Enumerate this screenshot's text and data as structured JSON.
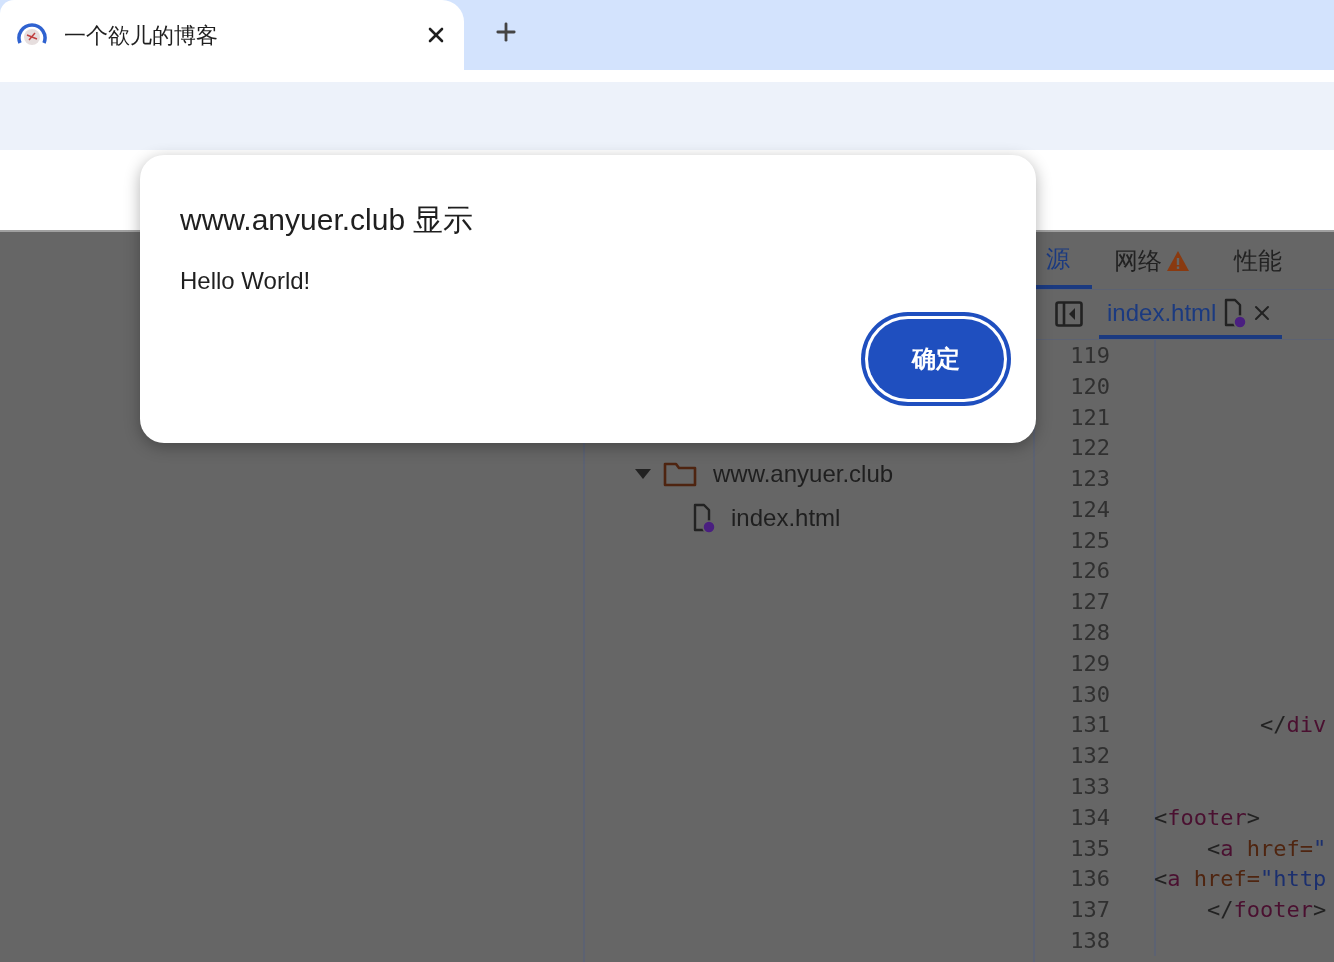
{
  "browser": {
    "tabs": [
      {
        "title": "一个欲儿的博客",
        "selected": true
      }
    ]
  },
  "devtools": {
    "panel_tabs": [
      {
        "label": "源",
        "selected": true,
        "warning": false
      },
      {
        "label": "网络",
        "selected": false,
        "warning": true
      },
      {
        "label": "性能",
        "selected": false,
        "warning": false
      }
    ],
    "editor_tabs": [
      {
        "label": "index.html",
        "selected": true
      }
    ],
    "navigator": [
      {
        "label": "www.anyuer.club",
        "kind": "folder",
        "expanded": true,
        "children": [
          {
            "label": "index.html",
            "kind": "file"
          }
        ]
      }
    ],
    "code_lines": [
      {
        "number": "119"
      },
      {
        "number": "120"
      },
      {
        "number": "121"
      },
      {
        "number": "122"
      },
      {
        "number": "123"
      },
      {
        "number": "124"
      },
      {
        "number": "125"
      },
      {
        "number": "126"
      },
      {
        "number": "127"
      },
      {
        "number": "128"
      },
      {
        "number": "129"
      },
      {
        "number": "130"
      },
      {
        "number": "131",
        "tokens": [
          {
            "kind": "punct",
            "text": "        </"
          },
          {
            "kind": "tag",
            "text": "div"
          }
        ]
      },
      {
        "number": "132"
      },
      {
        "number": "133"
      },
      {
        "number": "134",
        "tokens": [
          {
            "kind": "punct",
            "text": "<"
          },
          {
            "kind": "tag",
            "text": "footer"
          },
          {
            "kind": "punct",
            "text": ">"
          }
        ]
      },
      {
        "number": "135",
        "tokens": [
          {
            "kind": "punct",
            "text": "    <"
          },
          {
            "kind": "tag",
            "text": "a"
          },
          {
            "kind": "attr",
            "text": " href="
          },
          {
            "kind": "string",
            "text": "\""
          }
        ]
      },
      {
        "number": "136",
        "tokens": [
          {
            "kind": "punct",
            "text": "<"
          },
          {
            "kind": "tag",
            "text": "a"
          },
          {
            "kind": "attr",
            "text": " href="
          },
          {
            "kind": "string",
            "text": "\"http"
          }
        ]
      },
      {
        "number": "137",
        "tokens": [
          {
            "kind": "punct",
            "text": "    </"
          },
          {
            "kind": "tag",
            "text": "footer"
          },
          {
            "kind": "punct",
            "text": ">"
          }
        ]
      },
      {
        "number": "138"
      }
    ]
  },
  "dialog": {
    "title": "www.anyuer.club 显示",
    "message": "Hello World!",
    "button": "确定"
  }
}
